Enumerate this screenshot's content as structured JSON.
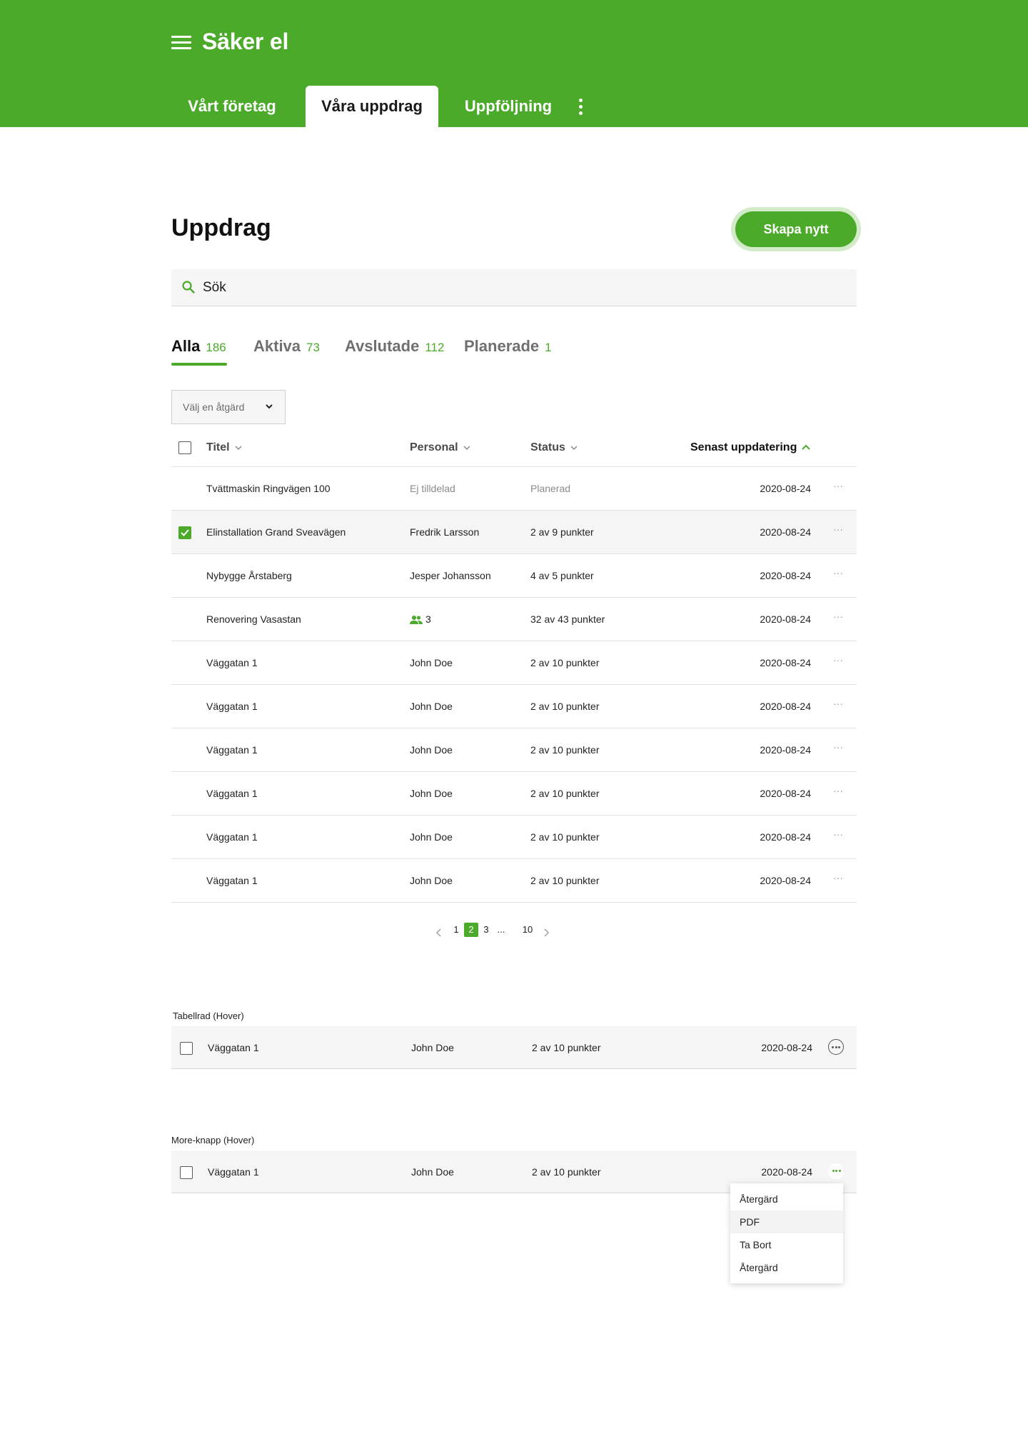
{
  "app": {
    "title": "Säker el",
    "nav_tabs": [
      {
        "label": "Vårt företag",
        "active": false
      },
      {
        "label": "Våra uppdrag",
        "active": true
      },
      {
        "label": "Uppföljning",
        "active": false
      }
    ],
    "accent_color": "#4caa2a"
  },
  "page": {
    "title": "Uppdrag",
    "create_button": "Skapa nytt"
  },
  "search": {
    "placeholder": "Sök"
  },
  "filter_tabs": [
    {
      "label": "Alla",
      "count": "186",
      "active": true
    },
    {
      "label": "Aktiva",
      "count": "73",
      "active": false
    },
    {
      "label": "Avslutade",
      "count": "112",
      "active": false
    },
    {
      "label": "Planerade",
      "count": "1",
      "active": false
    }
  ],
  "action_select": {
    "placeholder": "Välj en åtgärd"
  },
  "table": {
    "columns": {
      "title": "Titel",
      "staff": "Personal",
      "status": "Status",
      "updated": "Senast uppdatering"
    },
    "rows": [
      {
        "title": "Tvättmaskin Ringvägen 100",
        "staff": "Ej tilldelad",
        "status": "Planerad",
        "date": "2020-08-24",
        "selected": false,
        "muted": true
      },
      {
        "title": "Elinstallation Grand Sveavägen",
        "staff": "Fredrik Larsson",
        "status": "2 av 9 punkter",
        "date": "2020-08-24",
        "selected": true
      },
      {
        "title": "Nybygge Årstaberg",
        "staff": "Jesper Johansson",
        "status": "4 av 5 punkter",
        "date": "2020-08-24",
        "selected": false
      },
      {
        "title": "Renovering Vasastan",
        "staff": "3",
        "staff_icon": "group-icon",
        "status": "32 av 43 punkter",
        "date": "2020-08-24",
        "selected": false
      },
      {
        "title": "Väggatan 1",
        "staff": "John Doe",
        "status": "2 av 10 punkter",
        "date": "2020-08-24",
        "selected": false
      },
      {
        "title": "Väggatan 1",
        "staff": "John Doe",
        "status": "2 av 10 punkter",
        "date": "2020-08-24",
        "selected": false
      },
      {
        "title": "Väggatan 1",
        "staff": "John Doe",
        "status": "2 av 10 punkter",
        "date": "2020-08-24",
        "selected": false
      },
      {
        "title": "Väggatan 1",
        "staff": "John Doe",
        "status": "2 av 10 punkter",
        "date": "2020-08-24",
        "selected": false
      },
      {
        "title": "Väggatan 1",
        "staff": "John Doe",
        "status": "2 av 10 punkter",
        "date": "2020-08-24",
        "selected": false
      },
      {
        "title": "Väggatan 1",
        "staff": "John Doe",
        "status": "2 av 10 punkter",
        "date": "2020-08-24",
        "selected": false
      }
    ]
  },
  "pagination": {
    "pages": [
      "1",
      "2",
      "3",
      "...",
      "10"
    ],
    "current": "2"
  },
  "demo_hover_row": {
    "label": "Tabellrad (Hover)",
    "title": "Väggatan 1",
    "staff": "John Doe",
    "status": "2 av 10 punkter",
    "date": "2020-08-24"
  },
  "demo_more_button": {
    "label": "More-knapp (Hover)",
    "title": "Väggatan 1",
    "staff": "John Doe",
    "status": "2 av 10 punkter",
    "date": "2020-08-24",
    "menu": [
      "Återgärd",
      "PDF",
      "Ta Bort",
      "Återgärd"
    ]
  }
}
